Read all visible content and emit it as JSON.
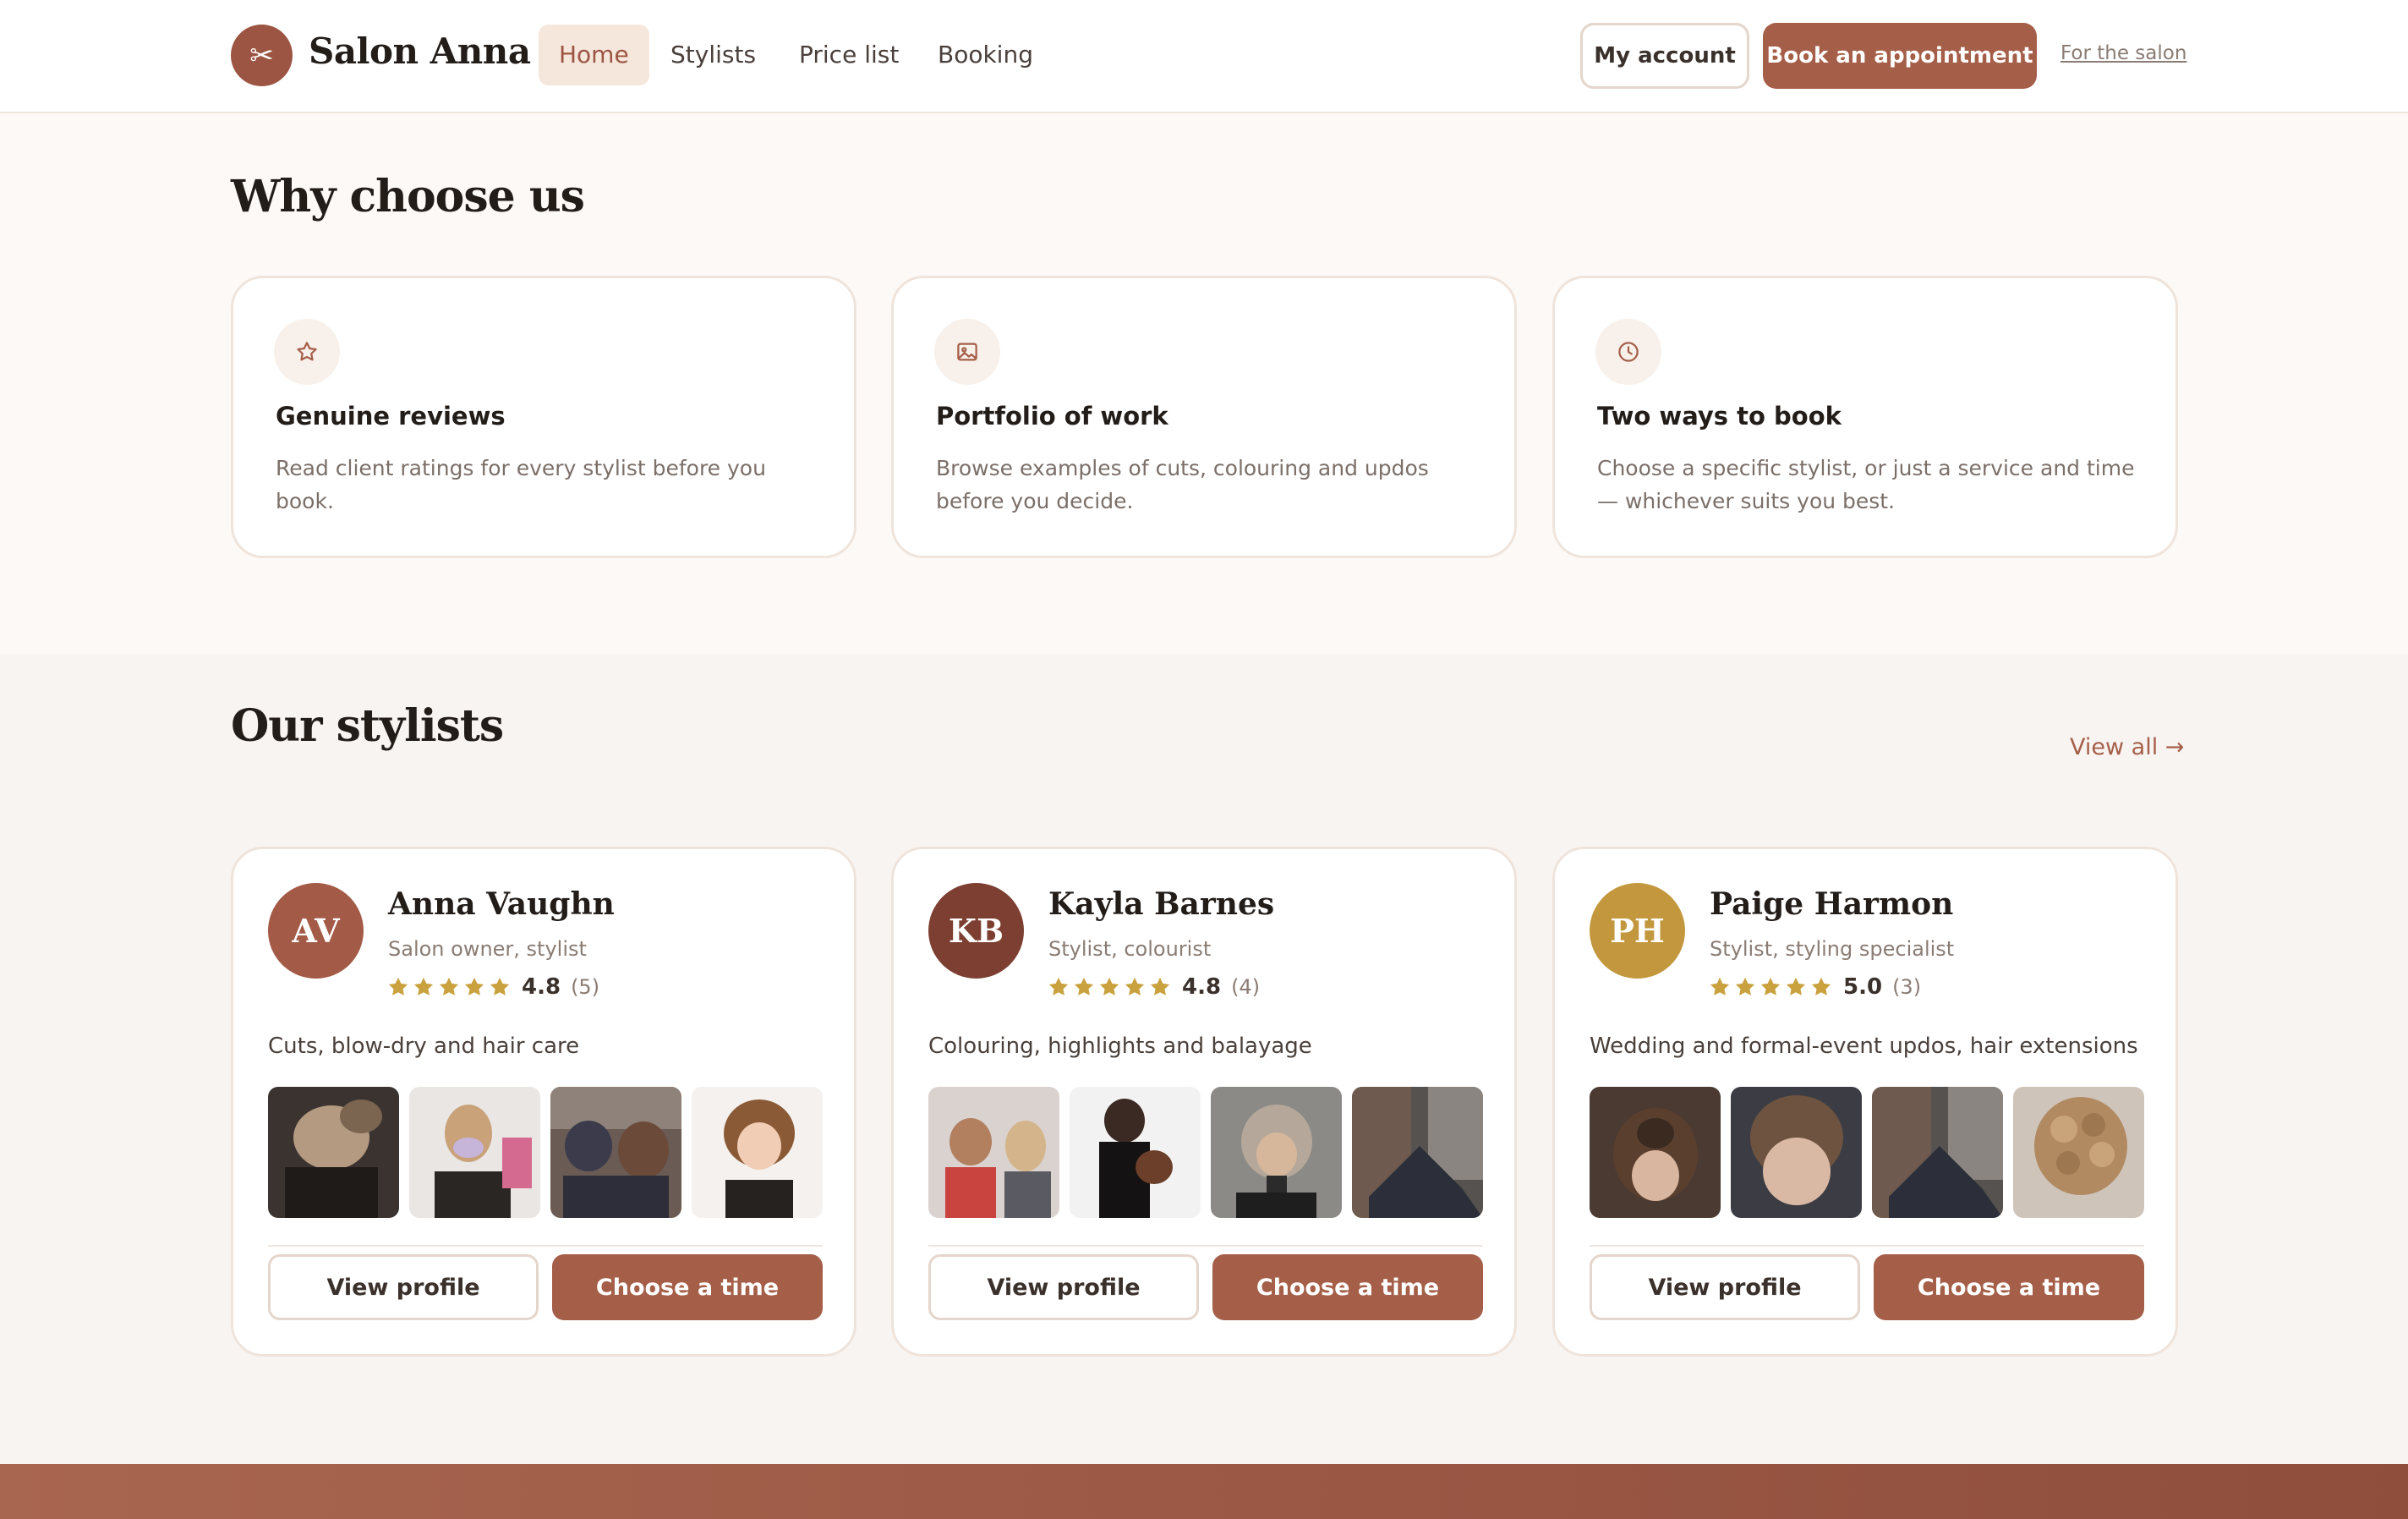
{
  "header": {
    "logo_icon": "scissors-icon",
    "logo_glyph": "✂",
    "brand": "Salon Anna",
    "nav": [
      {
        "label": "Home",
        "active": true
      },
      {
        "label": "Stylists",
        "active": false
      },
      {
        "label": "Price list",
        "active": false
      },
      {
        "label": "Booking",
        "active": false
      }
    ],
    "my_account": "My account",
    "book": "Book an appointment",
    "for_salon": "For the salon"
  },
  "why": {
    "title": "Why choose us",
    "cards": [
      {
        "icon": "star-icon",
        "title": "Genuine reviews",
        "text": "Read client ratings for every stylist before you book."
      },
      {
        "icon": "image-icon",
        "title": "Portfolio of work",
        "text": "Browse examples of cuts, colouring and updos before you decide."
      },
      {
        "icon": "clock-icon",
        "title": "Two ways to book",
        "text": "Choose a specific stylist, or just a service and time — whichever suits you best."
      }
    ]
  },
  "stylists": {
    "title": "Our stylists",
    "view_all": "View all →",
    "view_profile": "View profile",
    "choose_time": "Choose a time",
    "items": [
      {
        "initials": "AV",
        "avatar_color": "#a35a46",
        "name": "Anna Vaughn",
        "role": "Salon owner, stylist",
        "stars": 5,
        "rating": "4.8",
        "count": "(5)",
        "desc": "Cuts, blow-dry and hair care"
      },
      {
        "initials": "KB",
        "avatar_color": "#7d3f31",
        "name": "Kayla Barnes",
        "role": "Stylist, colourist",
        "stars": 5,
        "rating": "4.8",
        "count": "(4)",
        "desc": "Colouring, highlights and balayage"
      },
      {
        "initials": "PH",
        "avatar_color": "#c3973d",
        "name": "Paige Harmon",
        "role": "Stylist, styling specialist",
        "stars": 5,
        "rating": "5.0",
        "count": "(3)",
        "desc": "Wedding and formal-event updos, hair extensions"
      }
    ]
  },
  "colors": {
    "accent": "#a55f49",
    "star": "#c9a23f",
    "page_bg": "#fcf9f6"
  }
}
